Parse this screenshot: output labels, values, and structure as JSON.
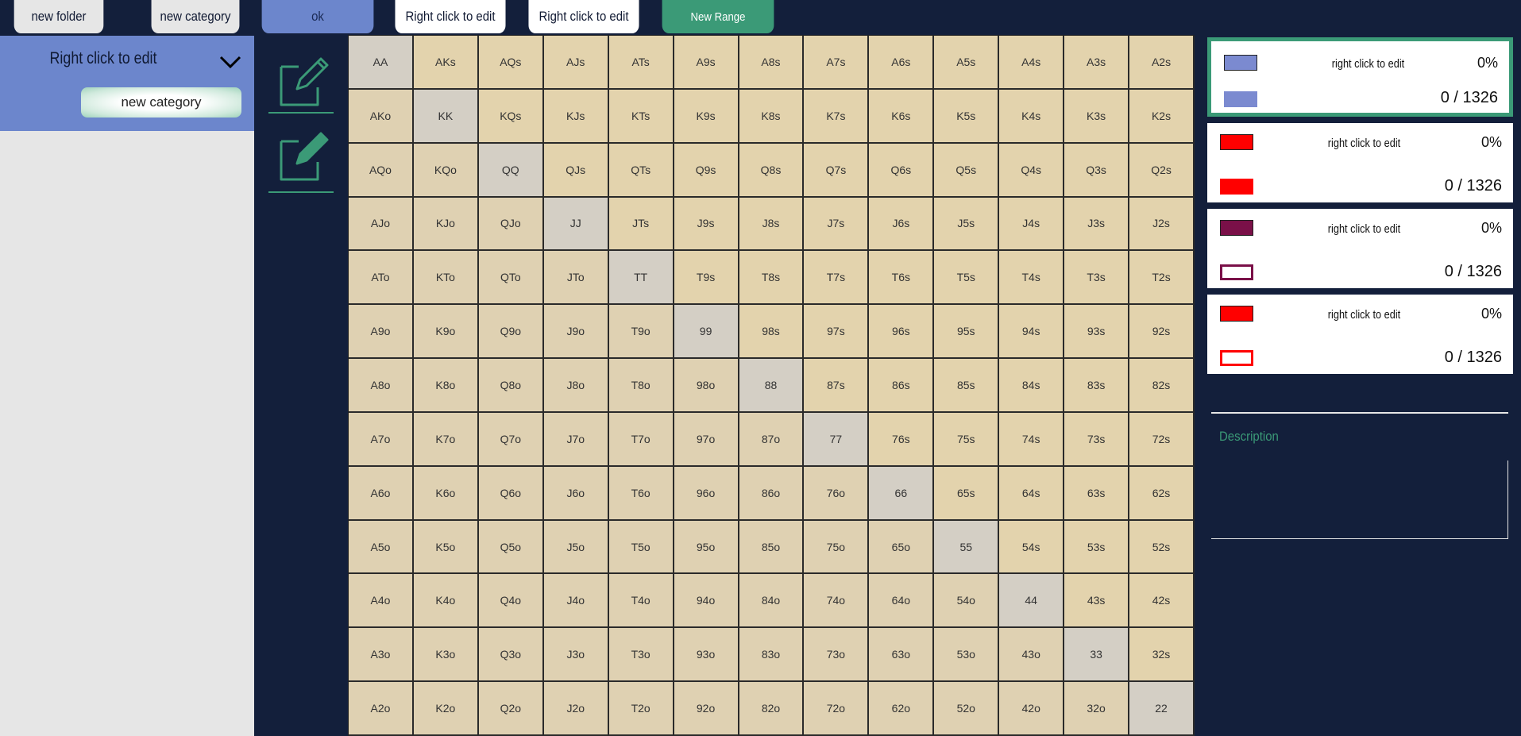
{
  "toolbar": {
    "new_folder": "new folder",
    "new_category": "new category",
    "ok": "ok",
    "tabs": [
      "Right click to edit",
      "Right click to edit"
    ],
    "new_range": "New Range"
  },
  "sidebar": {
    "folder_title": "Right click to edit",
    "category_input_value": "new category"
  },
  "grid": {
    "rows": [
      [
        "AA",
        "AKs",
        "AQs",
        "AJs",
        "ATs",
        "A9s",
        "A8s",
        "A7s",
        "A6s",
        "A5s",
        "A4s",
        "A3s",
        "A2s"
      ],
      [
        "AKo",
        "KK",
        "KQs",
        "KJs",
        "KTs",
        "K9s",
        "K8s",
        "K7s",
        "K6s",
        "K5s",
        "K4s",
        "K3s",
        "K2s"
      ],
      [
        "AQo",
        "KQo",
        "QQ",
        "QJs",
        "QTs",
        "Q9s",
        "Q8s",
        "Q7s",
        "Q6s",
        "Q5s",
        "Q4s",
        "Q3s",
        "Q2s"
      ],
      [
        "AJo",
        "KJo",
        "QJo",
        "JJ",
        "JTs",
        "J9s",
        "J8s",
        "J7s",
        "J6s",
        "J5s",
        "J4s",
        "J3s",
        "J2s"
      ],
      [
        "ATo",
        "KTo",
        "QTo",
        "JTo",
        "TT",
        "T9s",
        "T8s",
        "T7s",
        "T6s",
        "T5s",
        "T4s",
        "T3s",
        "T2s"
      ],
      [
        "A9o",
        "K9o",
        "Q9o",
        "J9o",
        "T9o",
        "99",
        "98s",
        "97s",
        "96s",
        "95s",
        "94s",
        "93s",
        "92s"
      ],
      [
        "A8o",
        "K8o",
        "Q8o",
        "J8o",
        "T8o",
        "98o",
        "88",
        "87s",
        "86s",
        "85s",
        "84s",
        "83s",
        "82s"
      ],
      [
        "A7o",
        "K7o",
        "Q7o",
        "J7o",
        "T7o",
        "97o",
        "87o",
        "77",
        "76s",
        "75s",
        "74s",
        "73s",
        "72s"
      ],
      [
        "A6o",
        "K6o",
        "Q6o",
        "J6o",
        "T6o",
        "96o",
        "86o",
        "76o",
        "66",
        "65s",
        "64s",
        "63s",
        "62s"
      ],
      [
        "A5o",
        "K5o",
        "Q5o",
        "J5o",
        "T5o",
        "95o",
        "85o",
        "75o",
        "65o",
        "55",
        "54s",
        "53s",
        "52s"
      ],
      [
        "A4o",
        "K4o",
        "Q4o",
        "J4o",
        "T4o",
        "94o",
        "84o",
        "74o",
        "64o",
        "54o",
        "44",
        "43s",
        "42s"
      ],
      [
        "A3o",
        "K3o",
        "Q3o",
        "J3o",
        "T3o",
        "93o",
        "83o",
        "73o",
        "63o",
        "53o",
        "43o",
        "33",
        "32s"
      ],
      [
        "A2o",
        "K2o",
        "Q2o",
        "J2o",
        "T2o",
        "92o",
        "82o",
        "72o",
        "62o",
        "52o",
        "42o",
        "32o",
        "22"
      ]
    ]
  },
  "legend": [
    {
      "label": "right click to edit",
      "pct": "0%",
      "count": "0 / 1326",
      "color": "#7b8ad0",
      "outline_color": "#7b8ad0",
      "second_filled": true,
      "selected": true
    },
    {
      "label": "right click to edit",
      "pct": "0%",
      "count": "0 / 1326",
      "color": "#ff0000",
      "outline_color": "#ff0000",
      "second_filled": true,
      "selected": false
    },
    {
      "label": "right click to edit",
      "pct": "0%",
      "count": "0 / 1326",
      "color": "#7a1048",
      "outline_color": "#7a1048",
      "second_filled": false,
      "selected": false
    },
    {
      "label": "right click to edit",
      "pct": "0%",
      "count": "0 / 1326",
      "color": "#ff0000",
      "outline_color": "#ff0000",
      "second_filled": false,
      "selected": false
    }
  ],
  "description": {
    "label": "Description",
    "text": ""
  },
  "colors": {
    "background": "#131f3b",
    "accent_green": "#3b9a77",
    "accent_blue": "#6c86cc"
  }
}
